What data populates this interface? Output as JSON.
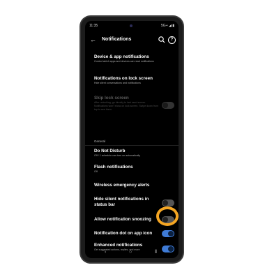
{
  "status_bar": {
    "time": "11:35",
    "signal": "5G+ ◢ ▮"
  },
  "app_bar": {
    "back_glyph": "←",
    "title": "Notifications",
    "help_glyph": "?"
  },
  "items": [
    {
      "title": "Device & app notifications",
      "subtitle": "Control which apps and devices can read notifications"
    },
    {
      "title": "Notifications on lock screen",
      "subtitle": "Hide silent conversations and notifications"
    },
    {
      "title": "Skip lock screen",
      "subtitle": "After unlocking, go directly to last used screen. Notifications won't show on lock screen. Swipe down from top to see them."
    },
    {
      "title": "Do Not Disturb",
      "subtitle": "Off / 1 schedule can turn on automatically"
    },
    {
      "title": "Flash notifications",
      "subtitle": "Off"
    },
    {
      "title": "Wireless emergency alerts"
    },
    {
      "title": "Hide silent notifications in status bar"
    },
    {
      "title": "Allow notification snoozing"
    },
    {
      "title": "Notification dot on app icon"
    },
    {
      "title": "Enhanced notifications",
      "subtitle": "Get suggested actions, replies, and more"
    }
  ],
  "section_general": "General",
  "toggles": {
    "skip_lock_screen": "disabled-off",
    "hide_silent": "off",
    "snoozing": "off",
    "notification_dot": "on",
    "enhanced": "on"
  },
  "nav": {
    "back": "‹",
    "home": "○",
    "recents": "⦀"
  },
  "colors": {
    "accent": "#3f7bd6",
    "highlight": "#f5a623"
  }
}
